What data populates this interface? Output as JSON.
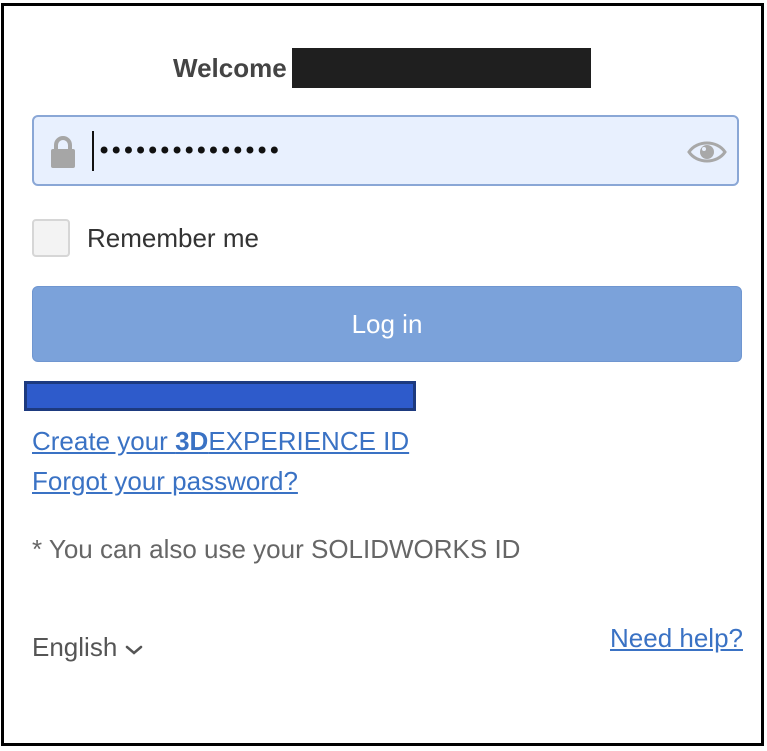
{
  "header": {
    "welcome_label": "Welcome"
  },
  "password": {
    "masked_value": "•••••••••••••••",
    "field_background": "#e8f0fe"
  },
  "remember": {
    "label": "Remember me",
    "checked": false
  },
  "login": {
    "label": "Log in",
    "color": "#7ba2da"
  },
  "links": {
    "create_prefix": "Create your ",
    "create_brand": "3D",
    "create_suffix": "EXPERIENCE ID",
    "forgot": "Forgot your password?",
    "color": "#3a72c4"
  },
  "note": "* You can also use your SOLIDWORKS ID",
  "footer": {
    "language": "English",
    "help": "Need help?"
  },
  "icons": {
    "field_icon": "lock-icon",
    "toggle_icon": "eye-icon",
    "language_icon": "chevron-down-icon"
  }
}
